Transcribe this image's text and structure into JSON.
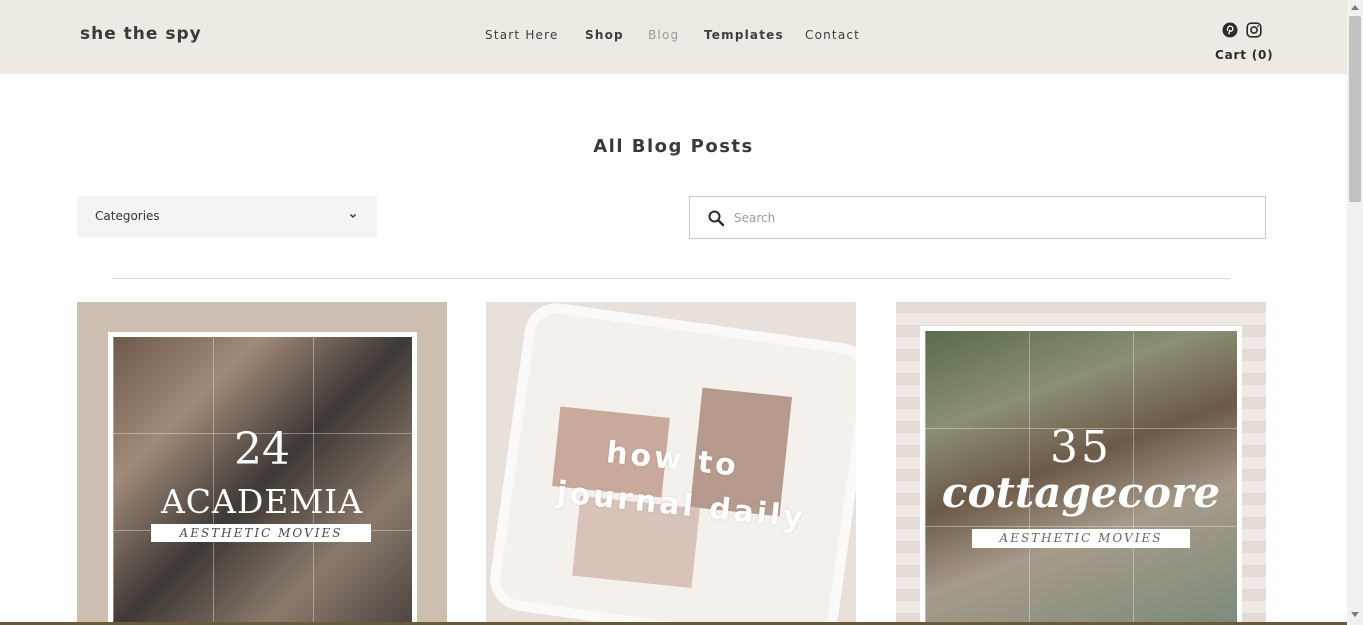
{
  "header": {
    "logo": "she the spy",
    "nav": [
      "Start Here",
      "Shop",
      "Blog",
      "Templates",
      "Contact"
    ],
    "active_nav": "Blog",
    "social_icons": [
      "pinterest-icon",
      "instagram-icon"
    ],
    "cart_label": "Cart (0)"
  },
  "main": {
    "title": "All Blog Posts",
    "categories_label": "Categories",
    "search_placeholder": "Search"
  },
  "posts": [
    {
      "number": "24",
      "headline": "ACADEMIA",
      "subline": "AESTHETIC MOVIES"
    },
    {
      "line1": "how to",
      "line2": "journal daily"
    },
    {
      "number": "35",
      "headline": "cottagecore",
      "subline": "AESTHETIC MOVIES"
    }
  ],
  "colors": {
    "header_bg": "#efe9e4",
    "text": "#2b2b2b",
    "muted_nav": "#9a9a9a"
  }
}
